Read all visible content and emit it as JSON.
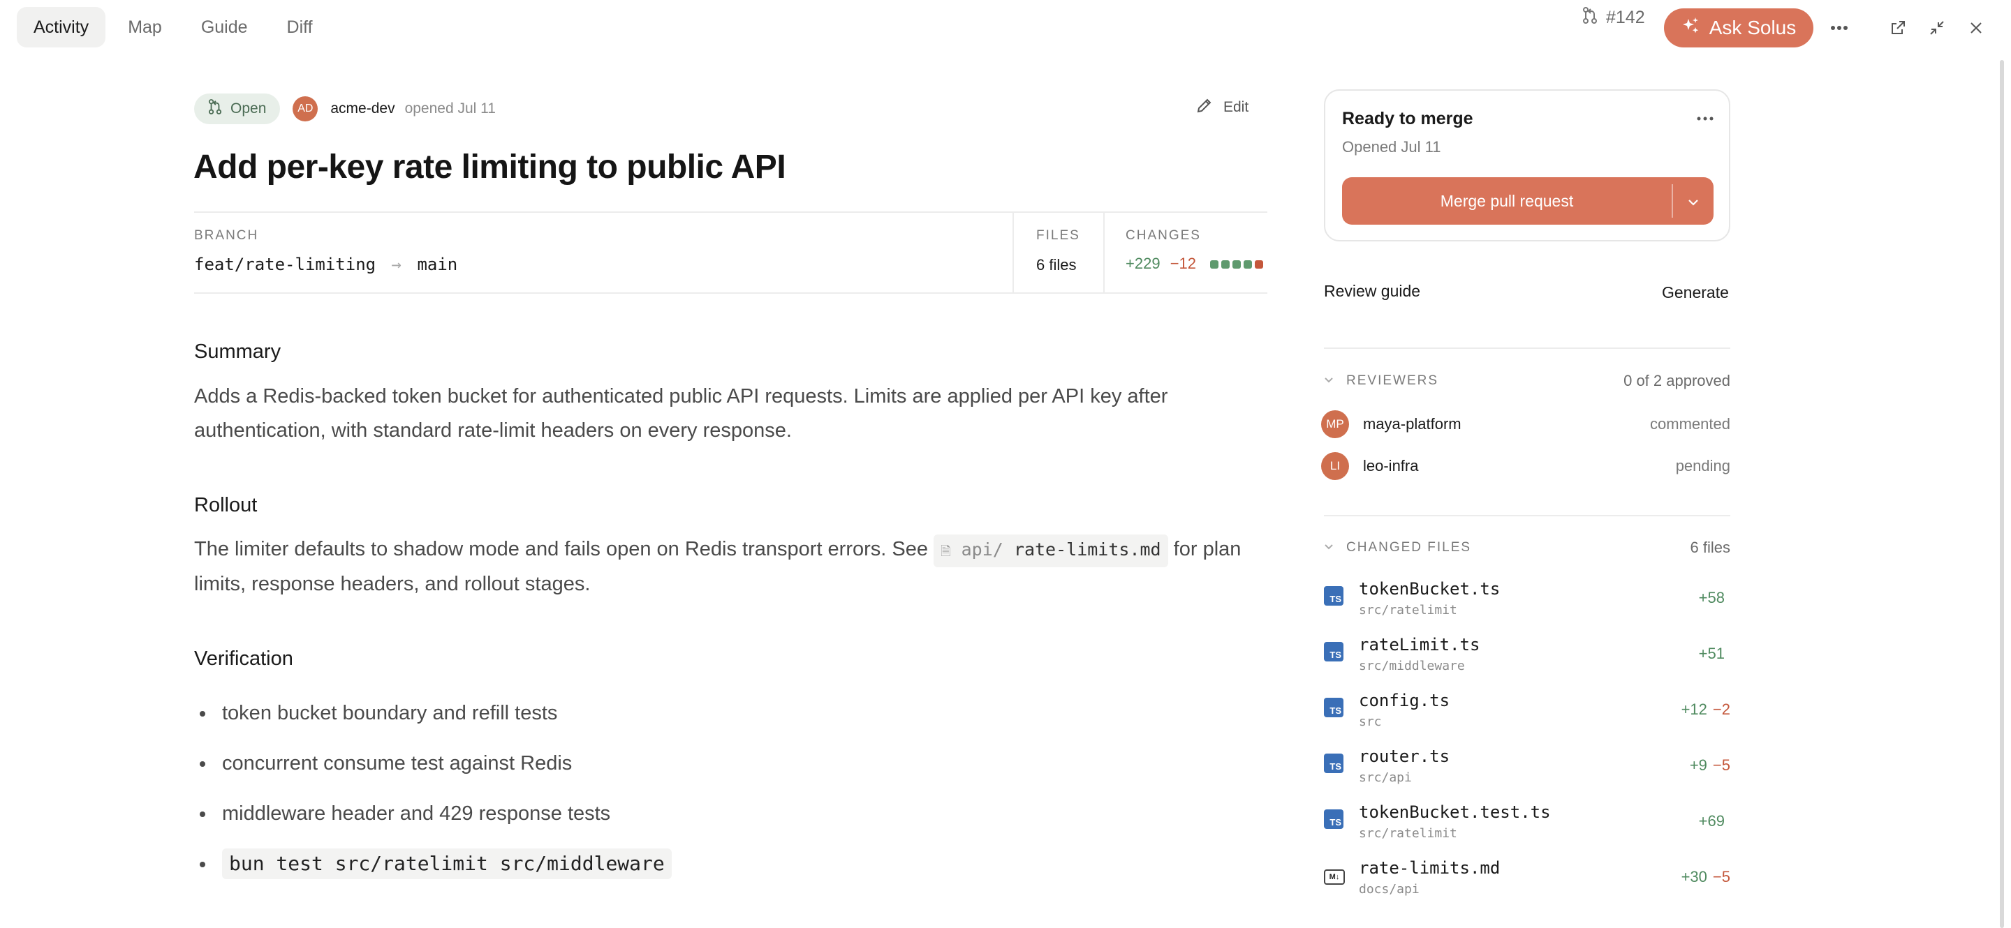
{
  "tabs": [
    {
      "label": "Activity",
      "active": true
    },
    {
      "label": "Map",
      "active": false
    },
    {
      "label": "Guide",
      "active": false
    },
    {
      "label": "Diff",
      "active": false
    }
  ],
  "header": {
    "pr_number": "#142",
    "ask_label": "Ask Solus",
    "accent_color": "#d9745a"
  },
  "pr": {
    "status": "Open",
    "author_initials": "AD",
    "author": "acme-dev",
    "opened": "opened Jul 11",
    "edit_label": "Edit",
    "title": "Add per-key rate limiting to public API",
    "branch_label": "BRANCH",
    "source_branch": "feat/rate-limiting",
    "target_branch": "main",
    "files_label": "FILES",
    "files_value": "6 files",
    "changes_label": "CHANGES",
    "additions": "+229",
    "deletions": "−12"
  },
  "body": {
    "summary_heading": "Summary",
    "summary_text_1": "Adds a Redis-backed token bucket for authenticated public API requests. Limits are applied per API key after",
    "summary_text_2": "authentication, with standard rate-limit headers on every response.",
    "rollout_heading": "Rollout",
    "rollout_text_pre": "The limiter defaults to shadow mode and fails open on Redis transport errors. See",
    "rollout_chip_dir": "api/",
    "rollout_chip_file": "rate-limits.md",
    "rollout_text_post": "for plan",
    "rollout_text_2": "limits, response headers, and rollout stages.",
    "verification_heading": "Verification",
    "verification_items": [
      "token bucket boundary and refill tests",
      "concurrent consume test against Redis",
      "middleware header and 429 response tests"
    ],
    "verification_command": "bun test src/ratelimit src/middleware"
  },
  "merge": {
    "title": "Ready to merge",
    "subtitle": "Opened Jul 11",
    "button_label": "Merge pull request"
  },
  "review_guide": {
    "label": "Review guide",
    "action": "Generate"
  },
  "reviewers": {
    "label": "REVIEWERS",
    "summary": "0 of 2 approved",
    "items": [
      {
        "initials": "MP",
        "name": "maya-platform",
        "state": "commented"
      },
      {
        "initials": "LI",
        "name": "leo-infra",
        "state": "pending"
      }
    ]
  },
  "changed_files": {
    "label": "CHANGED FILES",
    "count": "6 files",
    "items": [
      {
        "icon": "TS",
        "name": "tokenBucket.ts",
        "path": "src/ratelimit",
        "add": "+58",
        "del": ""
      },
      {
        "icon": "TS",
        "name": "rateLimit.ts",
        "path": "src/middleware",
        "add": "+51",
        "del": ""
      },
      {
        "icon": "TS",
        "name": "config.ts",
        "path": "src",
        "add": "+12",
        "del": "−2"
      },
      {
        "icon": "TS",
        "name": "router.ts",
        "path": "src/api",
        "add": "+9",
        "del": "−5"
      },
      {
        "icon": "TS",
        "name": "tokenBucket.test.ts",
        "path": "src/ratelimit",
        "add": "+69",
        "del": ""
      },
      {
        "icon": "M↓",
        "name": "rate-limits.md",
        "path": "docs/api",
        "add": "+30",
        "del": "−5"
      }
    ]
  }
}
